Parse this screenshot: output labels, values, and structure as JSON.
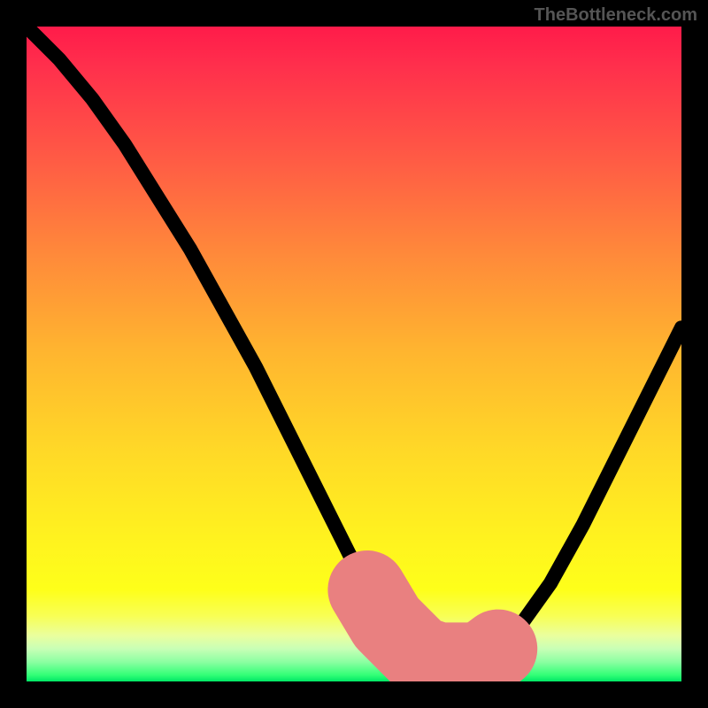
{
  "watermark": "TheBottleneck.com",
  "chart_data": {
    "type": "line",
    "title": "",
    "xlabel": "",
    "ylabel": "",
    "xlim": [
      0,
      100
    ],
    "ylim": [
      0,
      100
    ],
    "grid": false,
    "legend": false,
    "series": [
      {
        "name": "bottleneck-curve",
        "x": [
          0,
          5,
          10,
          15,
          20,
          25,
          30,
          35,
          40,
          45,
          50,
          52,
          55,
          58,
          60,
          63,
          65,
          68,
          70,
          72,
          75,
          80,
          85,
          90,
          95,
          100
        ],
        "y": [
          100,
          95,
          89,
          82,
          74,
          66,
          57,
          48,
          38,
          28,
          18,
          14,
          9,
          6,
          4,
          3,
          3,
          3,
          3.5,
          5,
          8,
          15,
          24,
          34,
          44,
          54
        ]
      }
    ],
    "highlight_segment": {
      "name": "salmon-valley-highlight",
      "x": [
        52,
        55,
        58,
        60,
        63,
        65,
        68,
        70,
        72
      ],
      "y": [
        14,
        9,
        6,
        4,
        3,
        3,
        3,
        3.5,
        5
      ]
    },
    "background_gradient": {
      "top": "#ff1b4a",
      "middle": "#ffe81f",
      "bottom": "#00e765"
    }
  }
}
